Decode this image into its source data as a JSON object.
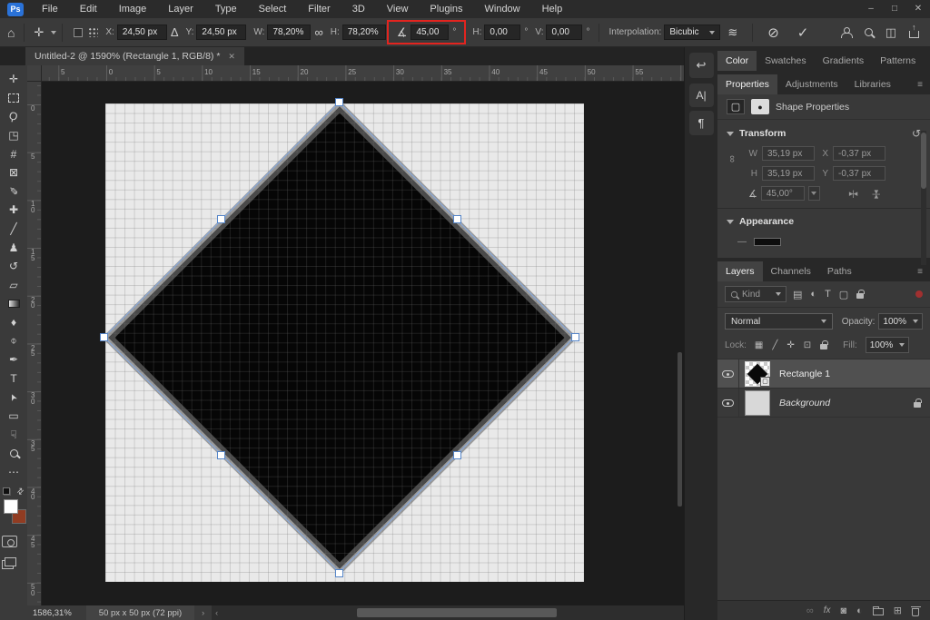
{
  "window": {
    "minimize": "–",
    "maximize": "□",
    "close": "✕"
  },
  "menubar": {
    "logo": "Ps",
    "items": [
      "File",
      "Edit",
      "Image",
      "Layer",
      "Type",
      "Select",
      "Filter",
      "3D",
      "View",
      "Plugins",
      "Window",
      "Help"
    ]
  },
  "options_bar": {
    "x_label": "X:",
    "x_value": "24,50 px",
    "delta_icon": "Δ",
    "y_label": "Y:",
    "y_value": "24,50 px",
    "w_label": "W:",
    "w_value": "78,20%",
    "link_icon": "∞",
    "h_label": "H:",
    "h_value": "78,20%",
    "angle_icon": "∡",
    "angle_value": "45,00",
    "degree": "°",
    "h2_label": "H:",
    "h2_value": "0,00",
    "v_label": "V:",
    "v_value": "0,00",
    "interpolation_label": "Interpolation:",
    "interpolation_value": "Bicubic",
    "home_icon": "⌂",
    "tool_icon": "✛",
    "warp_icon": "≋",
    "cancel_icon": "⊘",
    "commit_icon": "✓",
    "workspace_icon": "◫"
  },
  "document_tab": {
    "title": "Untitled-2 @ 1590% (Rectangle 1, RGB/8) *",
    "close": "✕"
  },
  "toolbar": {
    "tools": [
      {
        "name": "move-tool",
        "glyph": "✛"
      },
      {
        "name": "rectangular-marquee-tool",
        "glyph": "",
        "cls": "icon-marquee"
      },
      {
        "name": "lasso-tool",
        "glyph": "Ϙ",
        "cls": "rot15"
      },
      {
        "name": "object-selection-tool",
        "glyph": "◳"
      },
      {
        "name": "crop-tool",
        "glyph": "#"
      },
      {
        "name": "frame-tool",
        "glyph": "⊠"
      },
      {
        "name": "eyedropper-tool",
        "glyph": "✐",
        "cls": "flipx"
      },
      {
        "name": "healing-brush-tool",
        "glyph": "✚"
      },
      {
        "name": "brush-tool",
        "glyph": "╱",
        "cls": "thick"
      },
      {
        "name": "clone-stamp-tool",
        "glyph": "♟"
      },
      {
        "name": "history-brush-tool",
        "glyph": "↺"
      },
      {
        "name": "eraser-tool",
        "glyph": "▱"
      },
      {
        "name": "gradient-tool",
        "glyph": "",
        "cls": "icon-gradient"
      },
      {
        "name": "blur-tool",
        "glyph": "♦"
      },
      {
        "name": "dodge-tool",
        "glyph": "⌽"
      },
      {
        "name": "pen-tool",
        "glyph": "✒"
      },
      {
        "name": "type-tool",
        "glyph": "T"
      },
      {
        "name": "path-selection-tool",
        "glyph": "➤",
        "cls": "rotm115"
      },
      {
        "name": "rectangle-tool",
        "glyph": "▭"
      },
      {
        "name": "hand-tool",
        "glyph": "☟"
      },
      {
        "name": "zoom-tool",
        "glyph": "",
        "cls": "icon-zoomglass"
      },
      {
        "name": "more-tools",
        "glyph": "⋯"
      }
    ],
    "swap_icon": "⇄"
  },
  "rulers": {
    "top_labels": [
      "5",
      "0",
      "5",
      "10",
      "15",
      "20",
      "25",
      "30",
      "35",
      "40",
      "45",
      "50",
      "55"
    ],
    "left_labels": [
      "0",
      "5",
      "10",
      "15",
      "20",
      "25",
      "30",
      "35",
      "40",
      "45",
      "50"
    ]
  },
  "status_bar": {
    "zoom": "1586,31%",
    "doc_info": "50 px x 50 px (72 ppi)",
    "chevron": "›",
    "left_arrow": "‹"
  },
  "dock_strip": {
    "icons": [
      {
        "name": "history-panel-icon",
        "glyph": "↩"
      },
      {
        "name": "character-panel-icon",
        "glyph": "A|"
      },
      {
        "name": "paragraph-panel-icon",
        "glyph": "¶"
      }
    ]
  },
  "panels": {
    "menu_icon": "≡",
    "color_tabs": [
      {
        "label": "Color",
        "active": true
      },
      {
        "label": "Swatches",
        "active": false
      },
      {
        "label": "Gradients",
        "active": false
      },
      {
        "label": "Patterns",
        "active": false
      }
    ],
    "properties_tabs": [
      {
        "label": "Properties",
        "active": true
      },
      {
        "label": "Adjustments",
        "active": false
      },
      {
        "label": "Libraries",
        "active": false
      }
    ],
    "shape_properties": {
      "label": "Shape Properties",
      "mask_icon": "●",
      "frame_icon": "▢"
    },
    "transform": {
      "title": "Transform",
      "reset_icon": "↺",
      "chain_icon": "∞",
      "w_label": "W",
      "w_value": "35,19 px",
      "x_label": "X",
      "x_value": "-0,37 px",
      "h_label": "H",
      "h_value": "35,19 px",
      "y_label": "Y",
      "y_value": "-0,37 px",
      "angle_icon": "∡",
      "angle_value": "45,00°",
      "flip_h_icon": "▸|◂",
      "flip_v_icon": "▸|◂"
    },
    "appearance": {
      "title": "Appearance",
      "dash_icon": "—"
    },
    "layers_tabs": [
      {
        "label": "Layers",
        "active": true
      },
      {
        "label": "Channels",
        "active": false
      },
      {
        "label": "Paths",
        "active": false
      }
    ],
    "filter": {
      "kind_label": "Kind",
      "icons": [
        {
          "name": "filter-pixel-layers-icon",
          "glyph": "▤"
        },
        {
          "name": "filter-adjustment-layers-icon",
          "glyph": "◐"
        },
        {
          "name": "filter-type-layers-icon",
          "glyph": "T"
        },
        {
          "name": "filter-shape-layers-icon",
          "glyph": "▢"
        },
        {
          "name": "filter-locked-layers-icon",
          "glyph": "",
          "cls": "icon-lock"
        }
      ]
    },
    "blend": {
      "mode": "Normal",
      "opacity_label": "Opacity:",
      "opacity_value": "100%"
    },
    "lock": {
      "label": "Lock:",
      "icons": [
        {
          "name": "lock-transparency-icon",
          "glyph": "▦"
        },
        {
          "name": "lock-paint-icon",
          "glyph": "╱"
        },
        {
          "name": "lock-position-icon",
          "glyph": "✛"
        },
        {
          "name": "lock-artboard-icon",
          "glyph": "⊡"
        },
        {
          "name": "lock-all-icon",
          "glyph": "",
          "cls": "icon-lock"
        }
      ],
      "fill_label": "Fill:",
      "fill_value": "100%"
    },
    "layers": [
      {
        "name": "Rectangle 1",
        "selected": true
      },
      {
        "name": "Background",
        "selected": false,
        "locked": true
      }
    ],
    "bottom_icons": [
      {
        "name": "link-layers-icon",
        "glyph": "∞",
        "dim": true
      },
      {
        "name": "layer-effects-icon",
        "glyph": "fx",
        "cls": "pb-fx"
      },
      {
        "name": "layer-mask-icon",
        "glyph": "◙"
      },
      {
        "name": "adjustment-layer-icon",
        "glyph": "◐"
      },
      {
        "name": "layer-group-icon",
        "glyph": "",
        "cls": "icon-folder"
      },
      {
        "name": "new-layer-icon",
        "glyph": "⊞"
      },
      {
        "name": "delete-layer-icon",
        "glyph": "",
        "cls": "icon-trash"
      }
    ]
  },
  "colors": {
    "annotation_red": "#e3241f",
    "selection_blue": "#86abe4",
    "foreground_swatch": "#ffffff",
    "background_swatch": "#913c22",
    "shape_fill": "#060606"
  }
}
